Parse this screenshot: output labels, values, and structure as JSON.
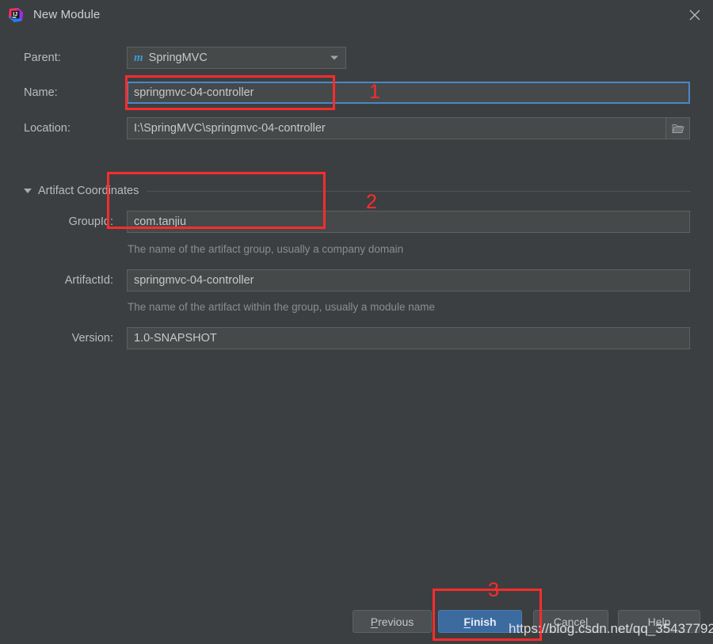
{
  "window": {
    "title": "New Module",
    "app_icon": "intellij-idea-icon",
    "close_icon": "close-icon"
  },
  "form": {
    "parent": {
      "label": "Parent:",
      "value": "SpringMVC",
      "icon": "maven-module-icon",
      "dropdown_icon": "chevron-down-icon"
    },
    "name": {
      "label": "Name:",
      "value": "springmvc-04-controller"
    },
    "location": {
      "label": "Location:",
      "value": "I:\\SpringMVC\\springmvc-04-controller",
      "browse_icon": "folder-icon"
    },
    "artifact_section": {
      "label": "Artifact Coordinates",
      "expand_icon": "triangle-down-icon"
    },
    "group_id": {
      "label": "GroupId:",
      "value": "com.tanjiu",
      "hint": "The name of the artifact group, usually a company domain"
    },
    "artifact_id": {
      "label": "ArtifactId:",
      "value": "springmvc-04-controller",
      "hint": "The name of the artifact within the group, usually a module name"
    },
    "version": {
      "label": "Version:",
      "value": "1.0-SNAPSHOT"
    }
  },
  "footer": {
    "previous": "Previous",
    "previous_mnemonic": "P",
    "finish": "Finish",
    "finish_mnemonic": "F",
    "cancel": "Cancel",
    "help": "Help"
  },
  "annotations": {
    "step1": "1",
    "step2": "2",
    "step3": "3",
    "watermark": "https://blog.csdn.net/qq_35437792",
    "highlight_color": "#fb2c2c"
  },
  "theme": {
    "dialog_bg": "#3c3f41",
    "field_bg": "#45494a",
    "text": "#bbbbbb",
    "hint_text": "#8a8d8f",
    "focus_border": "#4a88c7",
    "primary_button": "#3c6ba0"
  }
}
